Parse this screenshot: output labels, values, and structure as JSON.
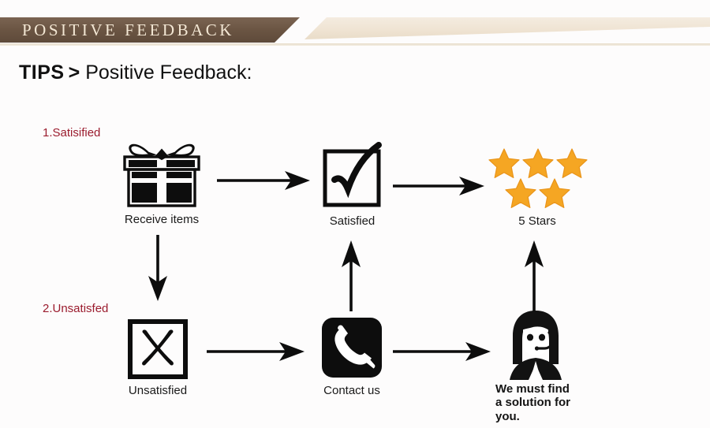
{
  "banner": {
    "title": "POSITIVE  FEEDBACK",
    "dark_color": "#6c5644",
    "text_color": "#f3e7d4",
    "light_color": "#efe3d2"
  },
  "heading": {
    "tips": "TIPS",
    "separator": ">",
    "subtitle": "Positive Feedback:"
  },
  "flow": {
    "steps": [
      {
        "number": "1.Satisified",
        "color": "#9b1c2e"
      },
      {
        "number": "2.Unsatisfed",
        "color": "#9b1c2e"
      }
    ],
    "nodes": [
      {
        "id": "receive-items",
        "label": "Receive items",
        "icon": "gift-box-icon"
      },
      {
        "id": "satisfied",
        "label": "Satisfied",
        "icon": "check-box-icon"
      },
      {
        "id": "five-stars",
        "label": "5 Stars",
        "icon": "five-stars-icon",
        "star_count": 5,
        "star_color": "#f5a623"
      },
      {
        "id": "unsatisfied",
        "label": "Unsatisfied",
        "icon": "cross-box-icon"
      },
      {
        "id": "contact-us",
        "label": "Contact us",
        "icon": "telephone-icon"
      },
      {
        "id": "agent",
        "label": "We must find\na solution for\nyou.",
        "icon": "support-agent-icon"
      }
    ],
    "agent_message_lines": [
      "We must find",
      "a solution for",
      "you."
    ],
    "arrows": [
      {
        "id": "receive-to-satisfied",
        "direction": "right"
      },
      {
        "id": "satisfied-to-stars",
        "direction": "right"
      },
      {
        "id": "receive-to-unsatisfied",
        "direction": "down"
      },
      {
        "id": "unsatisfied-to-contact",
        "direction": "right"
      },
      {
        "id": "contact-to-satisfied",
        "direction": "up"
      },
      {
        "id": "contact-to-agent",
        "direction": "right"
      },
      {
        "id": "agent-to-stars",
        "direction": "up"
      }
    ]
  }
}
